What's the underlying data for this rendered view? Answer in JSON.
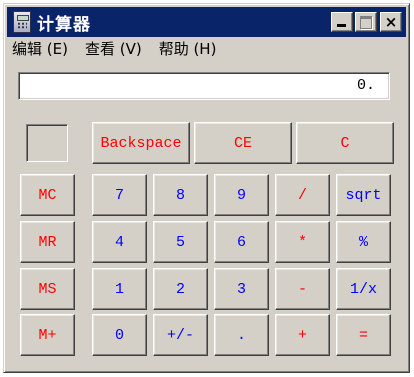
{
  "window": {
    "title": "计算器",
    "icon": "calculator-icon",
    "controls": {
      "minimize": "minimize-icon",
      "maximize": "maximize-icon",
      "close": "×"
    }
  },
  "menu": {
    "edit": "编辑 (E)",
    "view": "查看 (V)",
    "help": "帮助 (H)"
  },
  "display": {
    "value": "0."
  },
  "top_row": {
    "backspace": "Backspace",
    "ce": "CE",
    "c": "C"
  },
  "memory": {
    "mc": "MC",
    "mr": "MR",
    "ms": "MS",
    "mplus": "M+"
  },
  "keys": {
    "d7": "7",
    "d8": "8",
    "d9": "9",
    "d4": "4",
    "d5": "5",
    "d6": "6",
    "d1": "1",
    "d2": "2",
    "d3": "3",
    "d0": "0",
    "sign": "+/-",
    "dot": ".",
    "divide": "/",
    "multiply": "*",
    "minus": "-",
    "plus": "+",
    "sqrt": "sqrt",
    "percent": "%",
    "reciprocal": "1/x",
    "equals": "="
  },
  "colors": {
    "title_bar": "#0a246a",
    "face": "#d4d0c8",
    "operator_text": "#ff0000",
    "digit_text": "#0000ff"
  }
}
